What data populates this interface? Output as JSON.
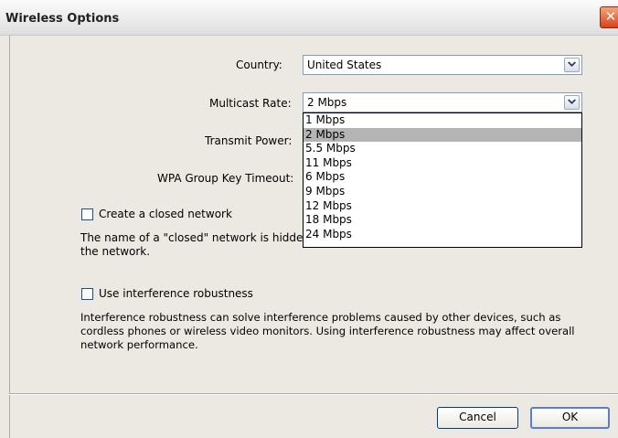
{
  "window": {
    "title": "Wireless Options",
    "close_glyph": "✕"
  },
  "country": {
    "label": "Country:",
    "value": "United States"
  },
  "multicast": {
    "label": "Multicast Rate:",
    "value": "2 Mbps",
    "options": [
      "1 Mbps",
      "2 Mbps",
      "5.5 Mbps",
      "11 Mbps",
      "6 Mbps",
      "9 Mbps",
      "12 Mbps",
      "18 Mbps",
      "24 Mbps"
    ],
    "selected_index": 1
  },
  "transmit_power": {
    "label": "Transmit Power:"
  },
  "wpa_timeout": {
    "label": "WPA Group Key Timeout:"
  },
  "closed_network": {
    "label": "Create a closed network",
    "checked": false,
    "desc_line1": "The name of a \"closed\" network is hidden.",
    "desc_line2": "the network."
  },
  "interference": {
    "label": "Use interference robustness",
    "checked": false,
    "desc_line1": "Interference robustness can solve interference problems caused by other devices, such as",
    "desc_line2": "cordless phones or wireless video monitors. Using interference robustness may affect overall",
    "desc_line3": "network performance."
  },
  "buttons": {
    "cancel": "Cancel",
    "ok": "OK"
  },
  "colors": {
    "selection": "#b4b4b4",
    "panel": "#ebe9e1",
    "close": "#d9421c"
  }
}
